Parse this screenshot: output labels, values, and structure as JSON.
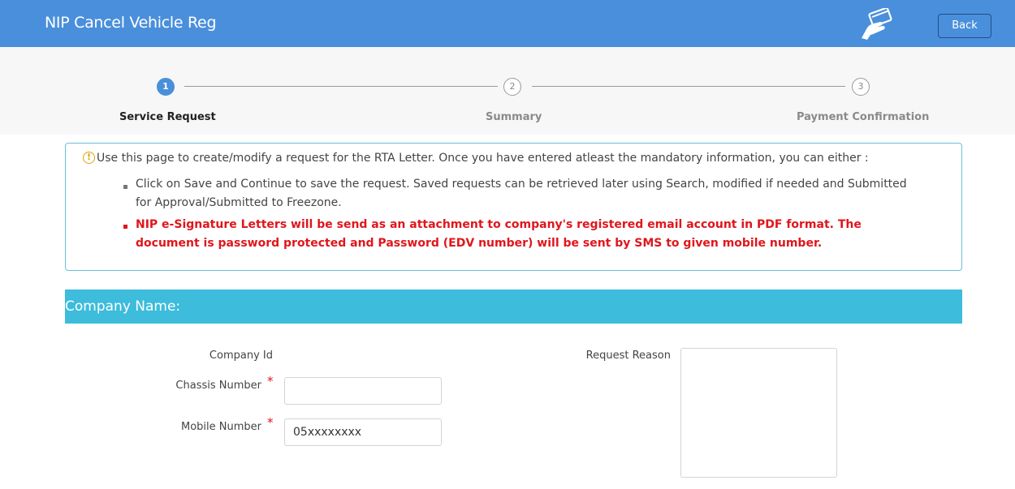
{
  "header": {
    "title": "NIP Cancel Vehicle Reg",
    "back_label": "Back",
    "bg_color": "#4a8fdb",
    "icon": "hand-card-icon"
  },
  "stepper": {
    "steps": [
      {
        "number": "1",
        "label": "Service Request",
        "state": "active"
      },
      {
        "number": "2",
        "label": "Summary",
        "state": "inactive"
      },
      {
        "number": "3",
        "label": "Payment Confirmation",
        "state": "inactive"
      }
    ],
    "accent_color": "#4a8fdb"
  },
  "info": {
    "intro": "Use this page to create/modify a request for the RTA Letter. Once you have entered atleast the mandatory information, you can either :",
    "bullets": [
      {
        "text": "Click on Save and Continue to save the request. Saved requests can be retrieved later using Search, modified if needed and Submitted for Approval/Submitted to Freezone.",
        "style": "normal"
      },
      {
        "text": "NIP e-Signature Letters will be send as an attachment to company's registered email account in PDF format. The document is password protected and Password (EDV number) will be sent by SMS to given mobile number.",
        "style": "warning",
        "color": "#e0161c"
      }
    ]
  },
  "section": {
    "title": "Company Name:",
    "color": "#3dbcdc"
  },
  "form": {
    "company_id_label": "Company Id",
    "chassis_label": "Chassis Number",
    "chassis_value": "",
    "mobile_label": "Mobile Number",
    "mobile_value": "05xxxxxxxx",
    "required_marker": "*",
    "reason_label": "Request Reason",
    "reason_value": ""
  }
}
